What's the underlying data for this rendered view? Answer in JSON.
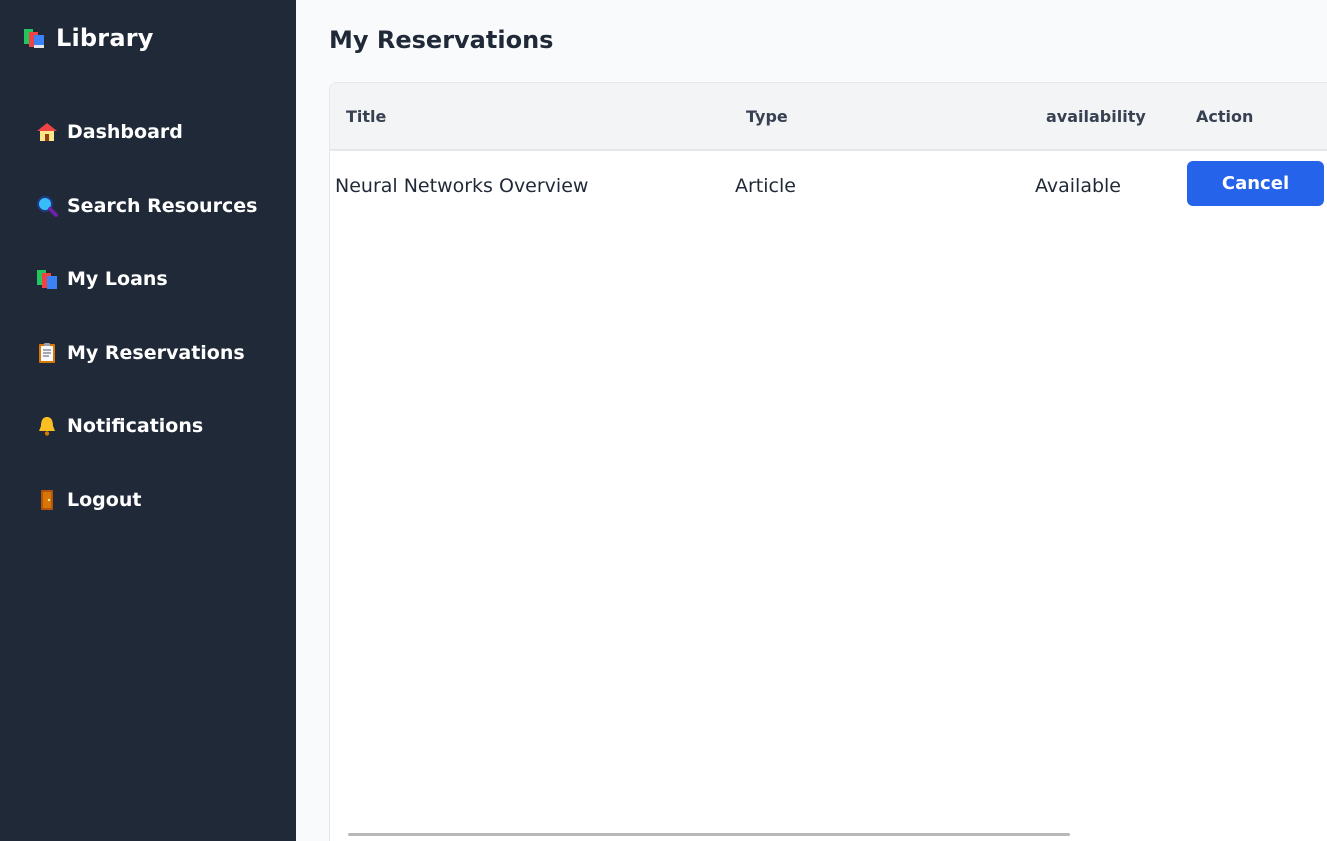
{
  "sidebar": {
    "brand": {
      "icon": "books-icon",
      "title": "Library"
    },
    "items": [
      {
        "icon": "house-icon",
        "label": "Dashboard"
      },
      {
        "icon": "magnifier-icon",
        "label": "Search Resources"
      },
      {
        "icon": "books-icon",
        "label": "My Loans"
      },
      {
        "icon": "clipboard-icon",
        "label": "My Reservations"
      },
      {
        "icon": "bell-icon",
        "label": "Notifications"
      },
      {
        "icon": "door-icon",
        "label": "Logout"
      }
    ]
  },
  "main": {
    "title": "My Reservations",
    "table": {
      "headers": [
        "Title",
        "Type",
        "availability",
        "Action"
      ],
      "rows": [
        {
          "title": "Neural Networks Overview",
          "type": "Article",
          "availability": "Available",
          "action": "Cancel"
        }
      ]
    }
  },
  "colors": {
    "sidebar_bg": "#1f2937",
    "accent": "#2563eb",
    "page_bg": "#f9fafb",
    "header_bg": "#f3f4f6"
  }
}
